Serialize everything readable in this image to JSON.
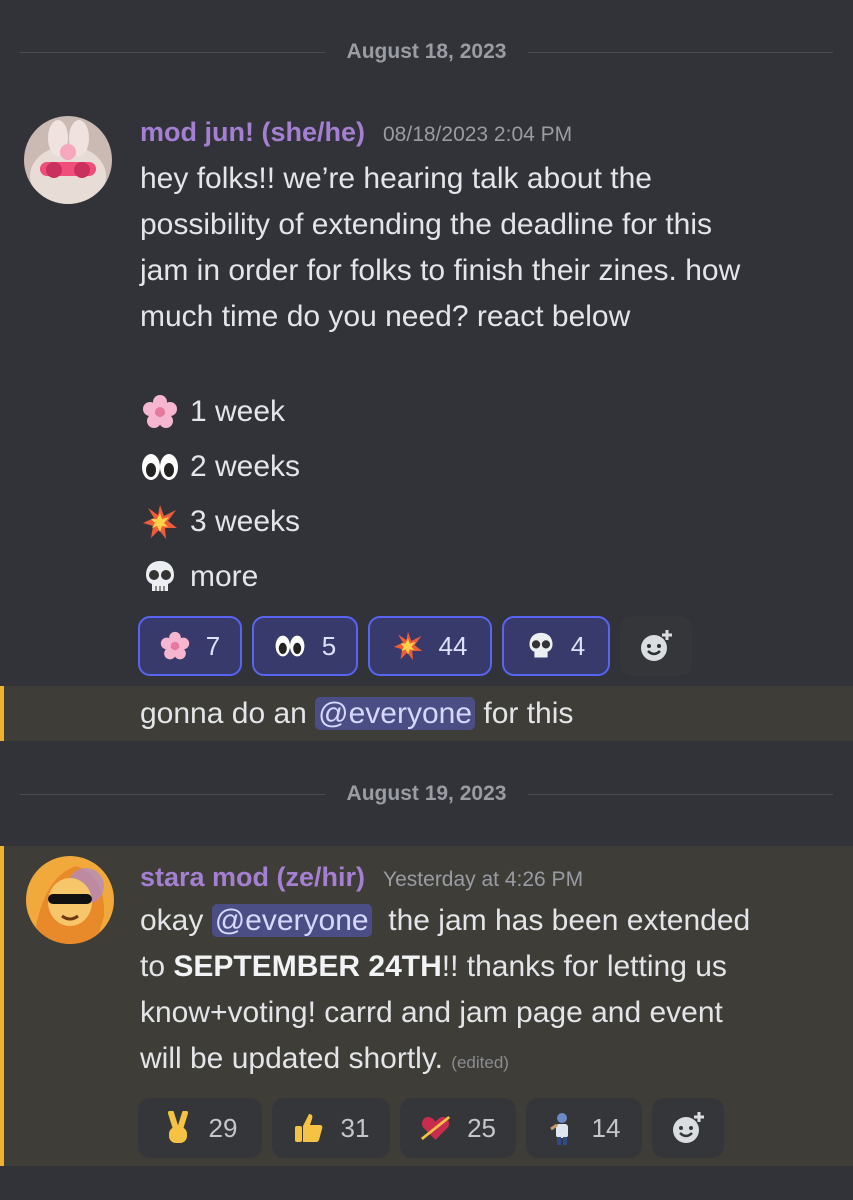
{
  "dividers": [
    "August 18, 2023",
    "August 19, 2023"
  ],
  "message1": {
    "author": "mod jun! (she/he)",
    "timestamp": "08/18/2023 2:04 PM",
    "lines": [
      "hey folks!! we’re hearing talk about the",
      "possibility of extending the deadline for this",
      "jam in order for folks to finish their zines. how",
      "much time do you need? react below"
    ],
    "options": [
      {
        "emoji": "cherry-blossom",
        "label": "1 week"
      },
      {
        "emoji": "eyes",
        "label": "2 weeks"
      },
      {
        "emoji": "collision",
        "label": "3 weeks"
      },
      {
        "emoji": "skull",
        "label": "more"
      }
    ],
    "reactions": [
      {
        "emoji": "cherry-blossom",
        "count": "7"
      },
      {
        "emoji": "eyes",
        "count": "5"
      },
      {
        "emoji": "collision",
        "count": "44"
      },
      {
        "emoji": "skull",
        "count": "4"
      }
    ],
    "followup": {
      "before": "gonna do an ",
      "mention": "@everyone",
      "after": " for this"
    }
  },
  "message2": {
    "author": "stara mod (ze/hir)",
    "timestamp": "Yesterday at 4:26 PM",
    "line1_before": "okay ",
    "mention": "@everyone",
    "line1_after": "  the jam has been extended",
    "line2_before": "to ",
    "line2_bold": "SEPTEMBER 24TH",
    "line2_after": "!! thanks for letting us",
    "line3": "know+voting! carrd and jam page and event",
    "line4": "will be updated shortly.",
    "edited": "(edited)",
    "reactions": [
      {
        "emoji": "victory-hand",
        "count": "29"
      },
      {
        "emoji": "thumbs-up",
        "count": "31"
      },
      {
        "emoji": "heart-arrow",
        "count": "25"
      },
      {
        "emoji": "person-figure",
        "count": "14"
      }
    ]
  },
  "colors": {
    "accent": "#5865f2",
    "author": "#a47fd2",
    "highlight_bar": "#f0b132"
  }
}
